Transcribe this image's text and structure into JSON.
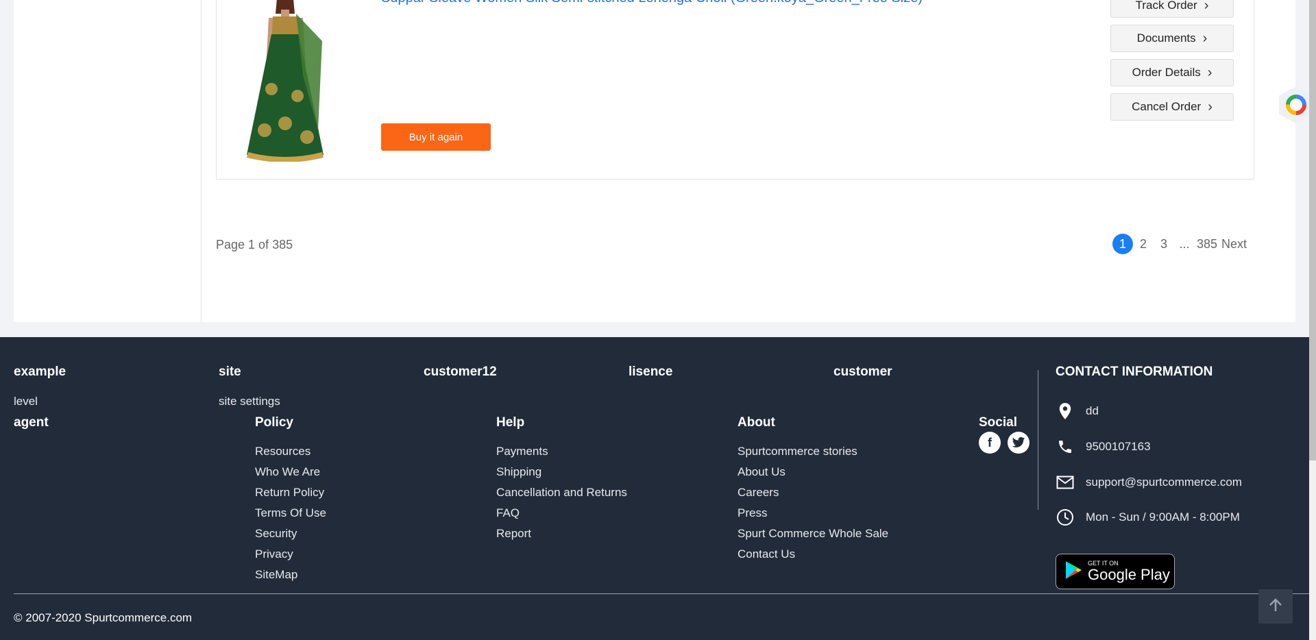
{
  "order": {
    "product_title": "Suppar Sleave Women Silk Semi-stitched Lehenga Choli (Green.koya_Green_Free Size)",
    "buy_again_label": "Buy it again",
    "actions": [
      "Track Order",
      "Documents",
      "Order Details",
      "Cancel Order"
    ]
  },
  "pagination": {
    "info": "Page 1 of 385",
    "pages": [
      "1",
      "2",
      "3"
    ],
    "ellipsis": "...",
    "last": "385",
    "next": "Next",
    "current": 1
  },
  "footer": {
    "top_headings": [
      "example",
      "site",
      "customer12",
      "lisence",
      "customer"
    ],
    "level_link": "level",
    "site_settings_link": "site settings",
    "agent_heading": "agent",
    "policy": {
      "heading": "Policy",
      "items": [
        "Resources",
        "Who We Are",
        "Return Policy",
        "Terms Of Use",
        "Security",
        "Privacy",
        "SiteMap"
      ]
    },
    "help": {
      "heading": "Help",
      "items": [
        "Payments",
        "Shipping",
        "Cancellation and Returns",
        "FAQ",
        "Report"
      ]
    },
    "about": {
      "heading": "About",
      "items": [
        "Spurtcommerce stories",
        "About Us",
        "Careers",
        "Press",
        "Spurt Commerce Whole Sale",
        "Contact Us"
      ]
    },
    "social": {
      "heading": "Social",
      "icons": [
        "facebook-icon",
        "twitter-icon"
      ]
    },
    "contact": {
      "heading": "CONTACT INFORMATION",
      "address": "dd",
      "phone": "9500107163",
      "email": "support@spurtcommerce.com",
      "hours": "Mon - Sun / 9:00AM - 8:00PM"
    },
    "google_play": {
      "small": "GET IT ON",
      "big": "Google Play"
    },
    "copyright": "© 2007-2020 Spurtcommerce.com"
  },
  "colors": {
    "accent_orange": "#fb6616",
    "link_blue": "#2a6fd6",
    "footer_bg": "#222b3a",
    "page_active": "#1a7ff5"
  }
}
